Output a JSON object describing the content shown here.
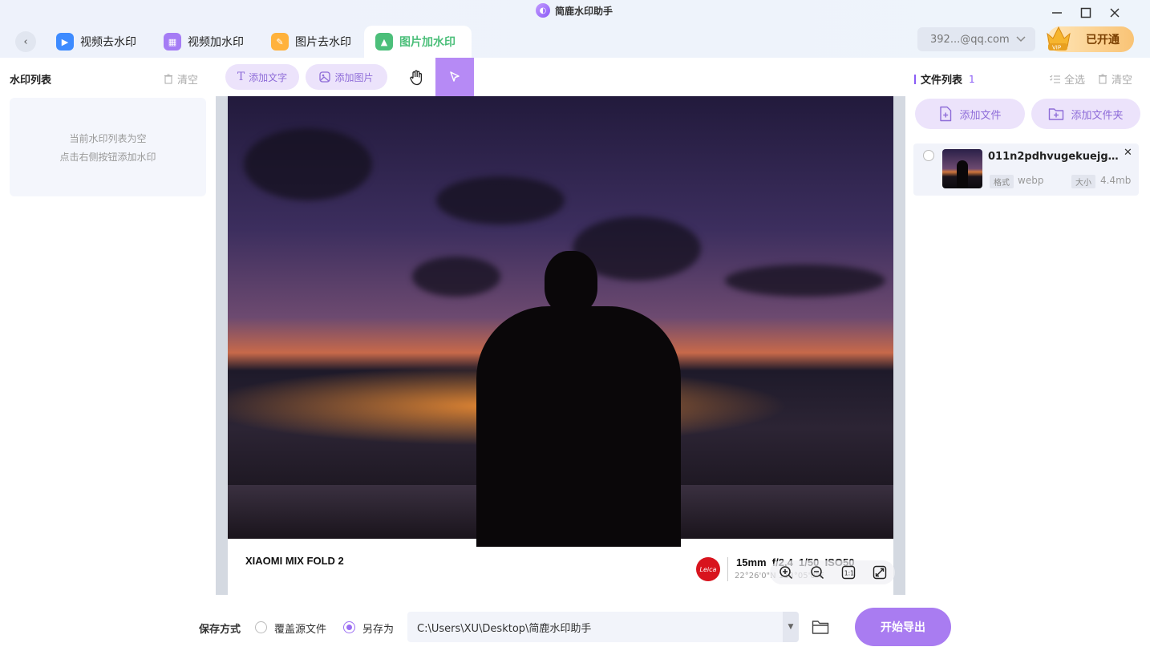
{
  "app": {
    "title": "简鹿水印助手"
  },
  "tabs": [
    {
      "label": "视频去水印",
      "icon": "video-remove-icon",
      "color": "#3d8bff"
    },
    {
      "label": "视频加水印",
      "icon": "video-add-icon",
      "color": "#a57cf5"
    },
    {
      "label": "图片去水印",
      "icon": "image-remove-icon",
      "color": "#ffb23c"
    },
    {
      "label": "图片加水印",
      "icon": "image-add-icon",
      "color": "#4cbf7a"
    }
  ],
  "account": {
    "email": "392...@qq.com",
    "vip_label": "已开通",
    "vip_badge": "VIP"
  },
  "watermark_panel": {
    "title": "水印列表",
    "clear_label": "清空",
    "empty_line1": "当前水印列表为空",
    "empty_line2": "点击右侧按钮添加水印"
  },
  "toolbar": {
    "add_text": "添加文字",
    "add_image": "添加图片",
    "text_glyph": "T"
  },
  "preview": {
    "device_name": "XIAOMI MIX FOLD 2",
    "leica": "Leica",
    "exif": "15mm  f/2.4  1/50  ISO50",
    "gps": "22°26'0\"N  113°05'0\"E",
    "zoom_1to1": "1:1"
  },
  "file_panel": {
    "title": "文件列表",
    "count": "1",
    "select_all": "全选",
    "clear_label": "清空",
    "add_file": "添加文件",
    "add_folder": "添加文件夹",
    "files": [
      {
        "name": "011n2pdhvugekuejgdem...",
        "format_label": "格式",
        "format": "webp",
        "size_label": "大小",
        "size": "4.4mb"
      }
    ]
  },
  "save": {
    "label": "保存方式",
    "option_overwrite": "覆盖源文件",
    "option_saveas": "另存为",
    "path": "C:\\Users\\XU\\Desktop\\简鹿水印助手",
    "export_label": "开始导出"
  },
  "colors": {
    "accent": "#a97cf1",
    "accent_light": "#ece3fb",
    "active_tab": "#4cbf7a",
    "leica_red": "#d8141e"
  }
}
